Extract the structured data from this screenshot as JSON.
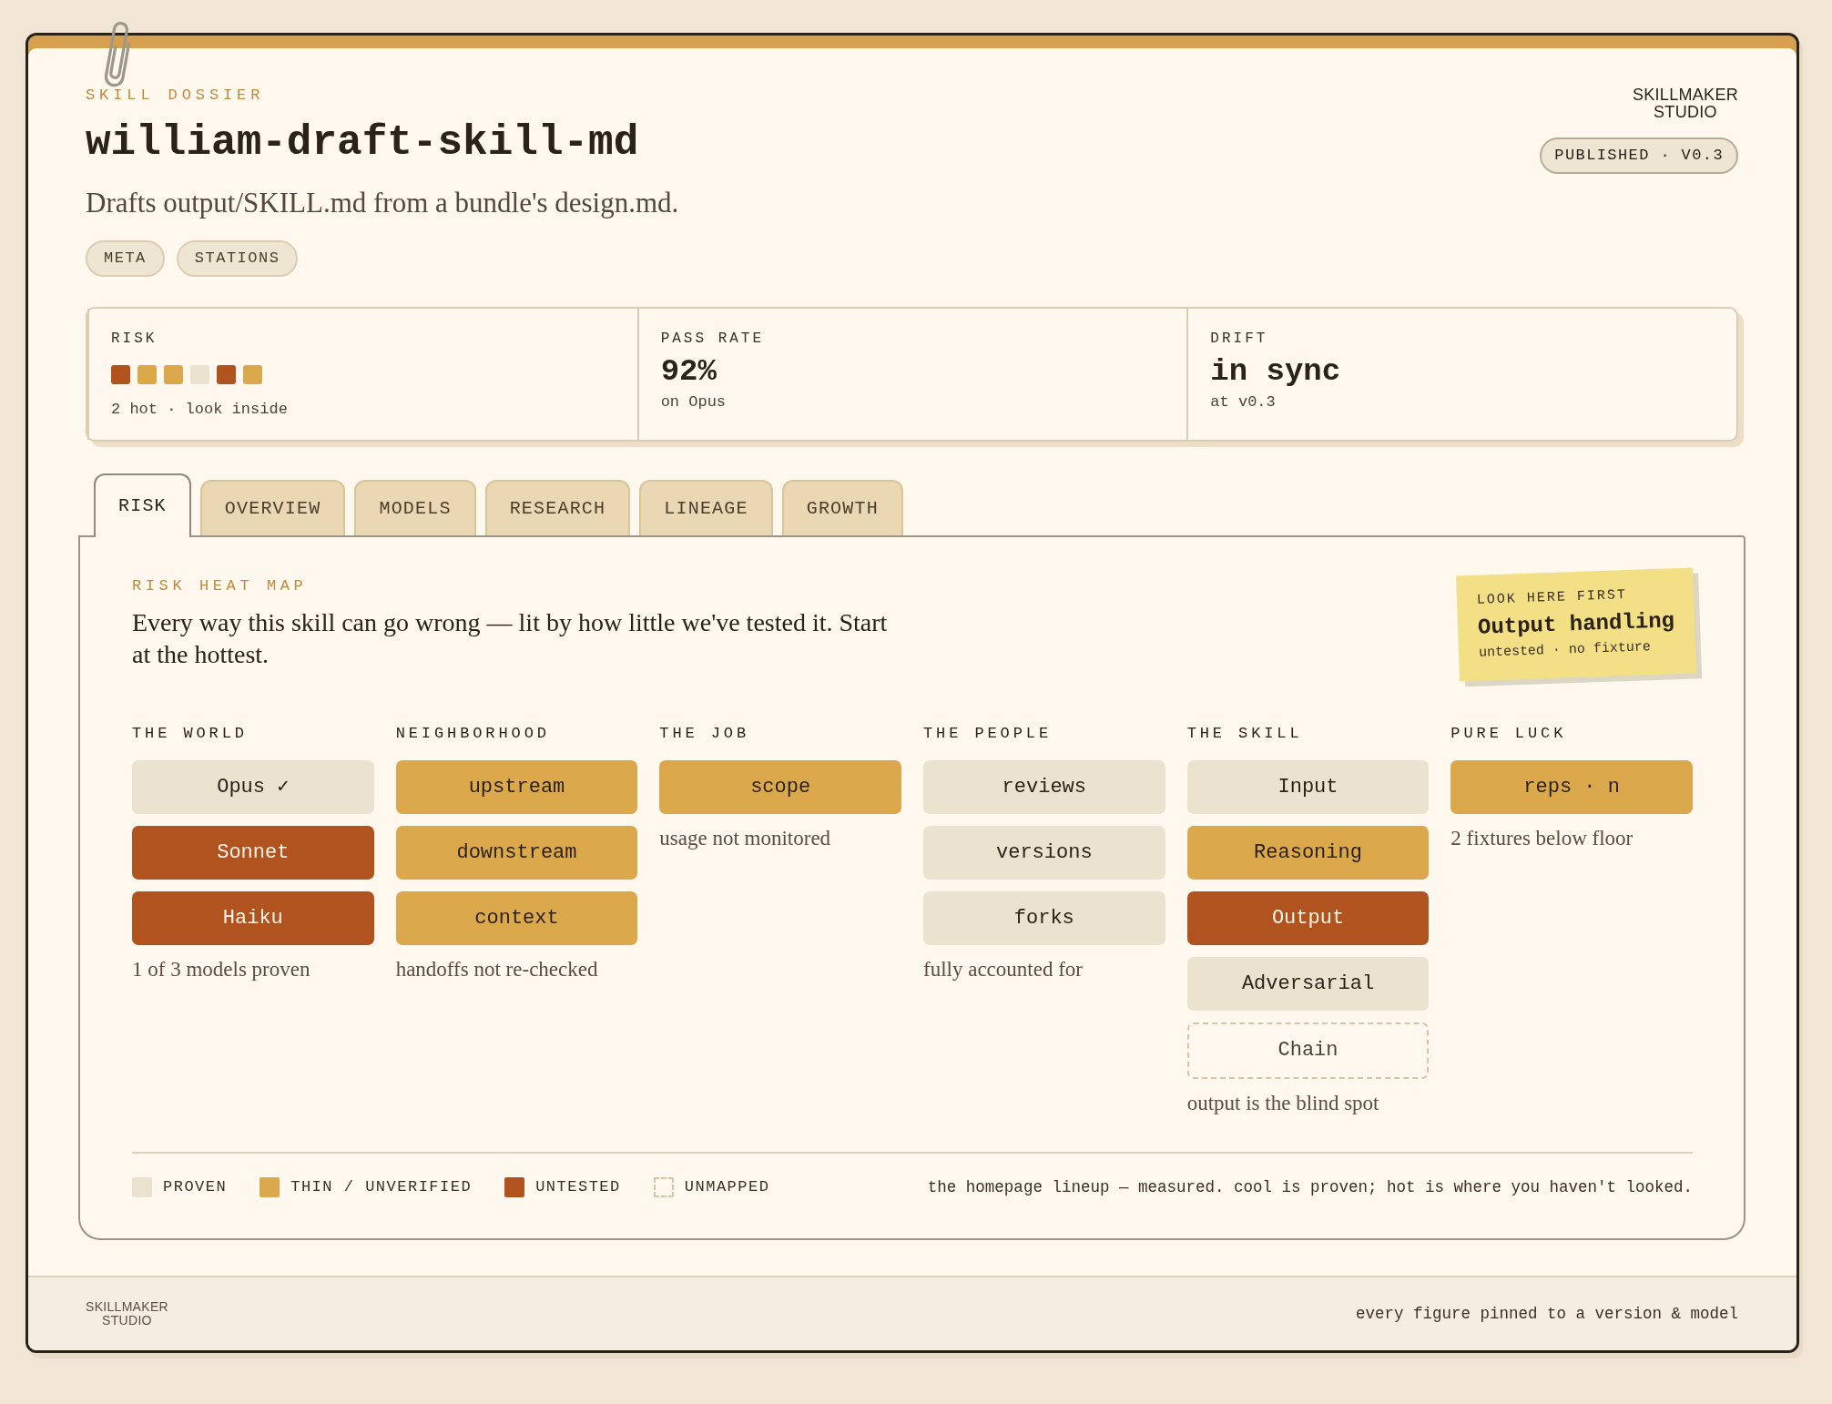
{
  "header": {
    "eyebrow": "SKILL DOSSIER",
    "title": "william-draft-skill-md",
    "description": "Drafts output/SKILL.md from a bundle's design.md.",
    "tags": [
      "META",
      "STATIONS"
    ],
    "logo": [
      "SKILLMAKER",
      "STUDIO"
    ],
    "status_badge": "PUBLISHED · V0.3"
  },
  "stats": [
    {
      "kind": "risk",
      "label": "RISK",
      "swatches": [
        {
          "color": "#b0531e"
        },
        {
          "color": "#dca84c"
        },
        {
          "color": "#dca84c"
        },
        {
          "color": "#ebe3d0"
        },
        {
          "color": "#b0531e"
        },
        {
          "color": "#dca84c"
        }
      ],
      "note": "2 hot · look inside"
    },
    {
      "kind": "value",
      "label": "PASS RATE",
      "value": "92%",
      "note": "on Opus"
    },
    {
      "kind": "value",
      "label": "DRIFT",
      "value": "in sync",
      "note": "at v0.3"
    }
  ],
  "tabs": [
    {
      "label": "RISK",
      "selected": true
    },
    {
      "label": "OVERVIEW",
      "selected": false
    },
    {
      "label": "MODELS",
      "selected": false
    },
    {
      "label": "RESEARCH",
      "selected": false
    },
    {
      "label": "LINEAGE",
      "selected": false
    },
    {
      "label": "GROWTH",
      "selected": false
    }
  ],
  "risk_panel": {
    "eyebrow": "RISK HEAT MAP",
    "lead": "Every way this skill can go wrong — lit by how little we've tested it. Start at the hottest.",
    "callout": {
      "eyebrow": "LOOK HERE FIRST",
      "title": "Output handling",
      "note": "untested · no fixture"
    },
    "groups": [
      {
        "title": "THE WORLD",
        "cells": [
          {
            "label": "Opus ✓",
            "color": "#ebe3d0",
            "mapped": true
          },
          {
            "label": "Sonnet",
            "color": "#b0531e",
            "mapped": true
          },
          {
            "label": "Haiku",
            "color": "#b0531e",
            "mapped": true
          }
        ],
        "note": "1 of 3 models proven"
      },
      {
        "title": "NEIGHBORHOOD",
        "cells": [
          {
            "label": "upstream",
            "color": "#dca84c",
            "mapped": true
          },
          {
            "label": "downstream",
            "color": "#dca84c",
            "mapped": true
          },
          {
            "label": "context",
            "color": "#dca84c",
            "mapped": true
          }
        ],
        "note": "handoffs not re-checked"
      },
      {
        "title": "THE JOB",
        "cells": [
          {
            "label": "scope",
            "color": "#dca84c",
            "mapped": true
          }
        ],
        "note": "usage not monitored"
      },
      {
        "title": "THE PEOPLE",
        "cells": [
          {
            "label": "reviews",
            "color": "#ebe3d0",
            "mapped": true
          },
          {
            "label": "versions",
            "color": "#ebe3d0",
            "mapped": true
          },
          {
            "label": "forks",
            "color": "#ebe3d0",
            "mapped": true
          }
        ],
        "note": "fully accounted for"
      },
      {
        "title": "THE SKILL",
        "cells": [
          {
            "label": "Input",
            "color": "#ebe3d0",
            "mapped": true
          },
          {
            "label": "Reasoning",
            "color": "#dca84c",
            "mapped": true
          },
          {
            "label": "Output",
            "color": "#b0531e",
            "mapped": true
          },
          {
            "label": "Adversarial",
            "color": "#ebe3d0",
            "mapped": true
          },
          {
            "label": "Chain",
            "color": "#d9c4a6",
            "mapped": false
          }
        ],
        "note": "output is the blind spot"
      },
      {
        "title": "PURE LUCK",
        "cells": [
          {
            "label": "reps · n",
            "color": "#dca84c",
            "mapped": true
          }
        ],
        "note": "2 fixtures below floor"
      }
    ],
    "legend": [
      {
        "label": "PROVEN",
        "color": "#ebe3d0",
        "mapped": true
      },
      {
        "label": "THIN / UNVERIFIED",
        "color": "#dca84c",
        "mapped": true
      },
      {
        "label": "UNTESTED",
        "color": "#b0531e",
        "mapped": true
      },
      {
        "label": "UNMAPPED",
        "color": "#d9c4a6",
        "mapped": false
      }
    ],
    "legend_note": "the homepage lineup — measured. cool is proven; hot is where you haven't looked."
  },
  "footer": {
    "logo": [
      "SKILLMAKER",
      "STUDIO"
    ],
    "note": "every figure pinned to a version & model"
  }
}
